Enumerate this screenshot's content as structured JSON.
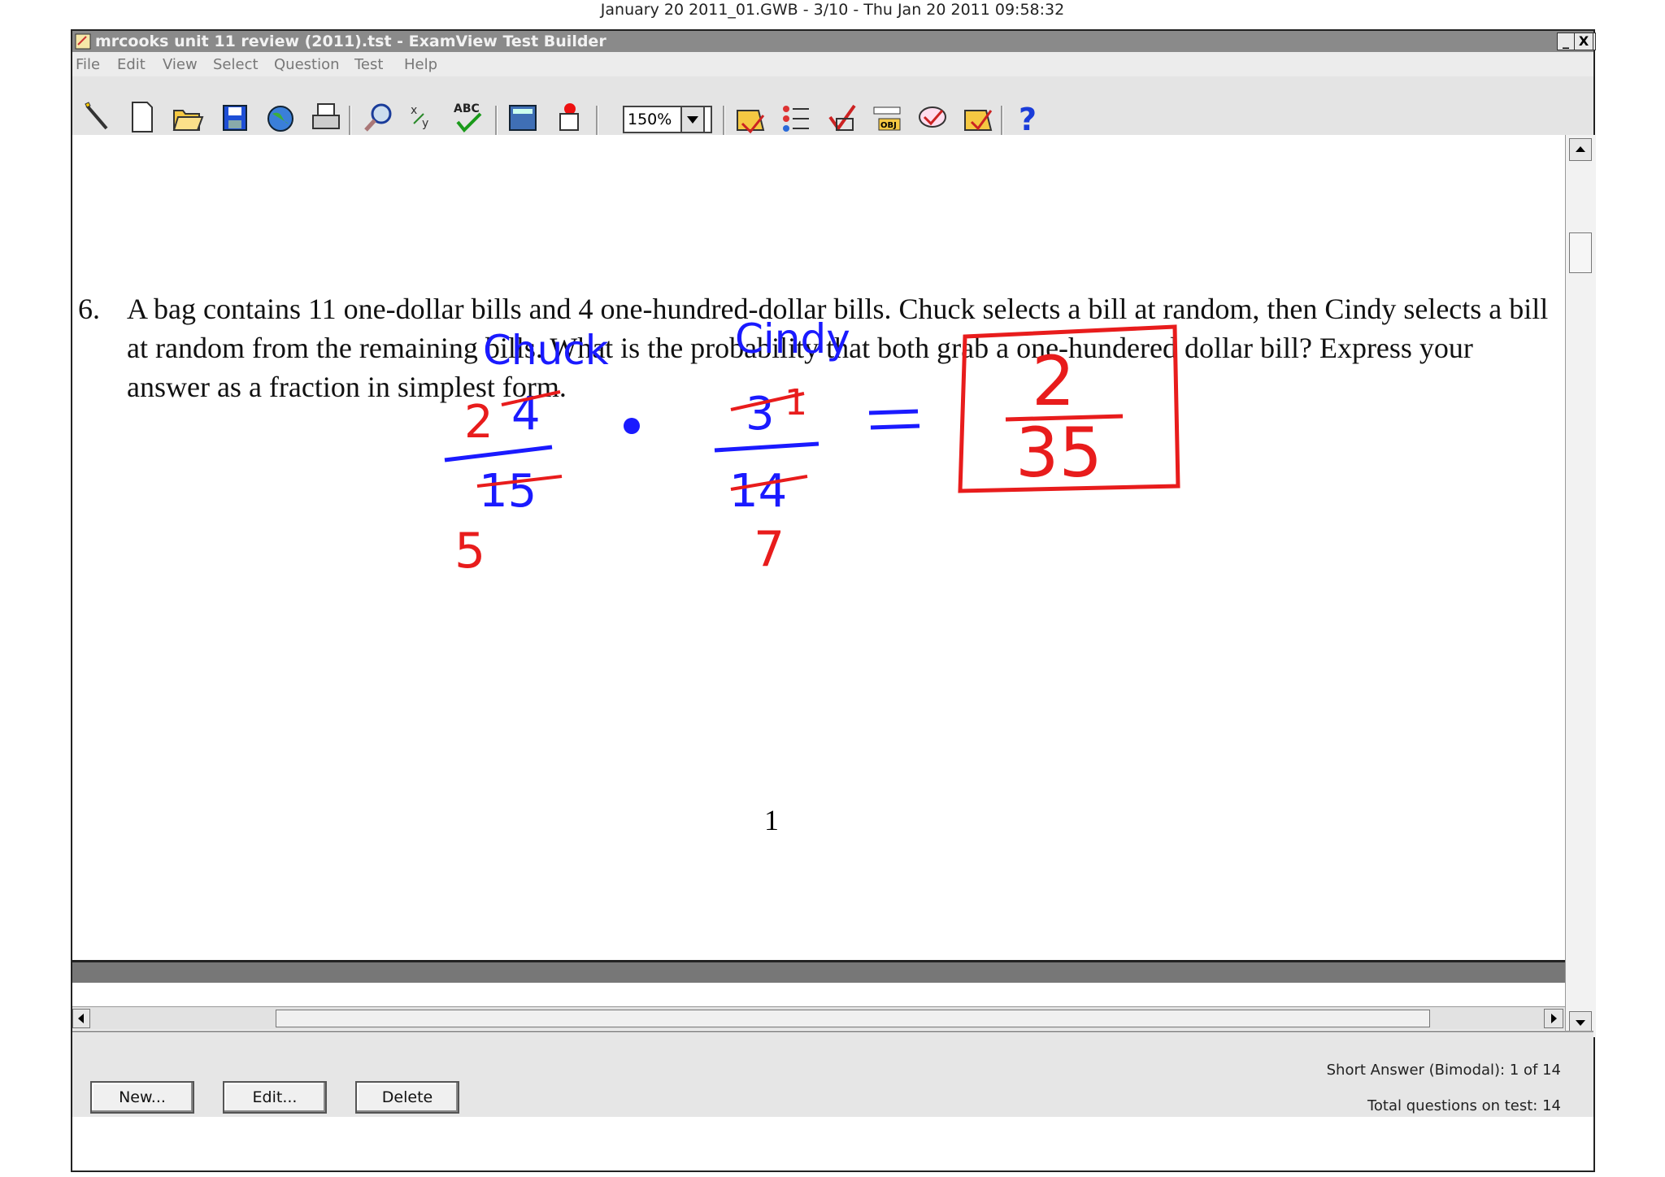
{
  "page_header": "January 20 2011_01.GWB - 3/10 - Thu Jan 20 2011 09:58:32",
  "window": {
    "title": "mrcooks unit 11 review (2011).tst - ExamView Test Builder",
    "controls": [
      "_",
      "▫",
      "X"
    ]
  },
  "menu": {
    "items": [
      {
        "label": "File"
      },
      {
        "label": "Edit"
      },
      {
        "label": "View"
      },
      {
        "label": "Select"
      },
      {
        "label": "Question"
      },
      {
        "label": "Test"
      },
      {
        "label": "Help"
      }
    ]
  },
  "toolbar": {
    "zoom": "150%",
    "icons": [
      "wand-icon",
      "new-document-icon",
      "open-folder-icon",
      "save-icon",
      "globe-icon",
      "print-icon",
      "find-icon",
      "variables-icon",
      "spell-check-icon",
      "calculator-icon",
      "pushpin-icon",
      "question-edit-icon",
      "numbered-list-icon",
      "check-icon",
      "objective-icon",
      "answer-check-icon",
      "test-check-icon",
      "help-icon"
    ]
  },
  "question": {
    "number": "6.",
    "text": "A bag contains 11 one-dollar bills and 4 one-hundred-dollar bills. Chuck selects a bill at random, then Cindy selects a bill at random from the remaining bills. What is the probability that both grab a one-hundered dollar bill? Express your answer as a fraction in simplest form."
  },
  "handwriting": {
    "chuck_label": "Chuck",
    "cindy_label": "Cindy",
    "chuck_num": "4",
    "chuck_den": "15",
    "chuck_num_reduced": "2",
    "chuck_den_reduced": "5",
    "cindy_num": "3",
    "cindy_num_reduced": "1",
    "cindy_den": "14",
    "cindy_den_reduced": "7",
    "answer_num": "2",
    "answer_den": "35",
    "ink_blue": "#1a1aff",
    "ink_red": "#e81c1c"
  },
  "page_number": "1",
  "buttons": {
    "new": "New...",
    "edit": "Edit...",
    "delete": "Delete"
  },
  "status": {
    "question_type": "Short Answer (Bimodal): 1 of 14",
    "total": "Total questions on test: 14"
  }
}
